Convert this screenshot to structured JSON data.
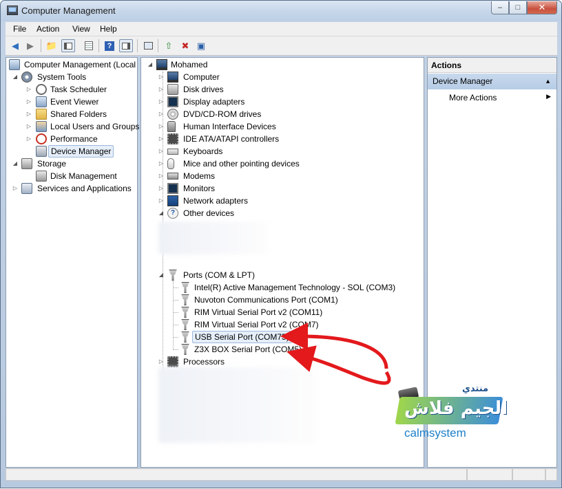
{
  "window": {
    "title": "Computer Management",
    "minimize": "–",
    "maximize": "□",
    "close": "✕"
  },
  "menu": [
    "File",
    "Action",
    "View",
    "Help"
  ],
  "left_tree": {
    "root": "Computer Management (Local",
    "system_tools": "System Tools",
    "items": [
      "Task Scheduler",
      "Event Viewer",
      "Shared Folders",
      "Local Users and Groups",
      "Performance",
      "Device Manager"
    ],
    "storage": "Storage",
    "disk_management": "Disk Management",
    "services": "Services and Applications"
  },
  "device_tree": {
    "root": "Mohamed",
    "categories": [
      {
        "label": "Computer",
        "icon": "computer-icon"
      },
      {
        "label": "Disk drives",
        "icon": "disk-drive-icon"
      },
      {
        "label": "Display adapters",
        "icon": "display-adapter-icon"
      },
      {
        "label": "DVD/CD-ROM drives",
        "icon": "dvd-icon"
      },
      {
        "label": "Human Interface Devices",
        "icon": "hid-icon"
      },
      {
        "label": "IDE ATA/ATAPI controllers",
        "icon": "ide-icon"
      },
      {
        "label": "Keyboards",
        "icon": "keyboard-icon"
      },
      {
        "label": "Mice and other pointing devices",
        "icon": "mouse-icon"
      },
      {
        "label": "Modems",
        "icon": "modem-icon"
      },
      {
        "label": "Monitors",
        "icon": "monitor-icon"
      },
      {
        "label": "Network adapters",
        "icon": "network-adapter-icon"
      },
      {
        "label": "Other devices",
        "icon": "unknown-device-icon"
      }
    ],
    "ports_category": "Ports (COM & LPT)",
    "ports": [
      "Intel(R) Active Management Technology - SOL (COM3)",
      "Nuvoton Communications Port (COM1)",
      "RIM Virtual Serial Port v2 (COM11)",
      "RIM Virtual Serial Port v2 (COM7)",
      "USB Serial Port (COM75)",
      "Z3X BOX Serial Port (COM5)"
    ],
    "processors": "Processors"
  },
  "actions": {
    "header": "Actions",
    "section": "Device Manager",
    "item": "More Actions"
  },
  "watermark": {
    "arabic_top": "منتدي",
    "arabic_main": "الجيم فلاش",
    "brand": "calmsystem"
  },
  "colors": {
    "annotation_arrow": "#e3191c",
    "selection_bg": "#e5eef9",
    "actions_band": "#c8d9ed"
  }
}
